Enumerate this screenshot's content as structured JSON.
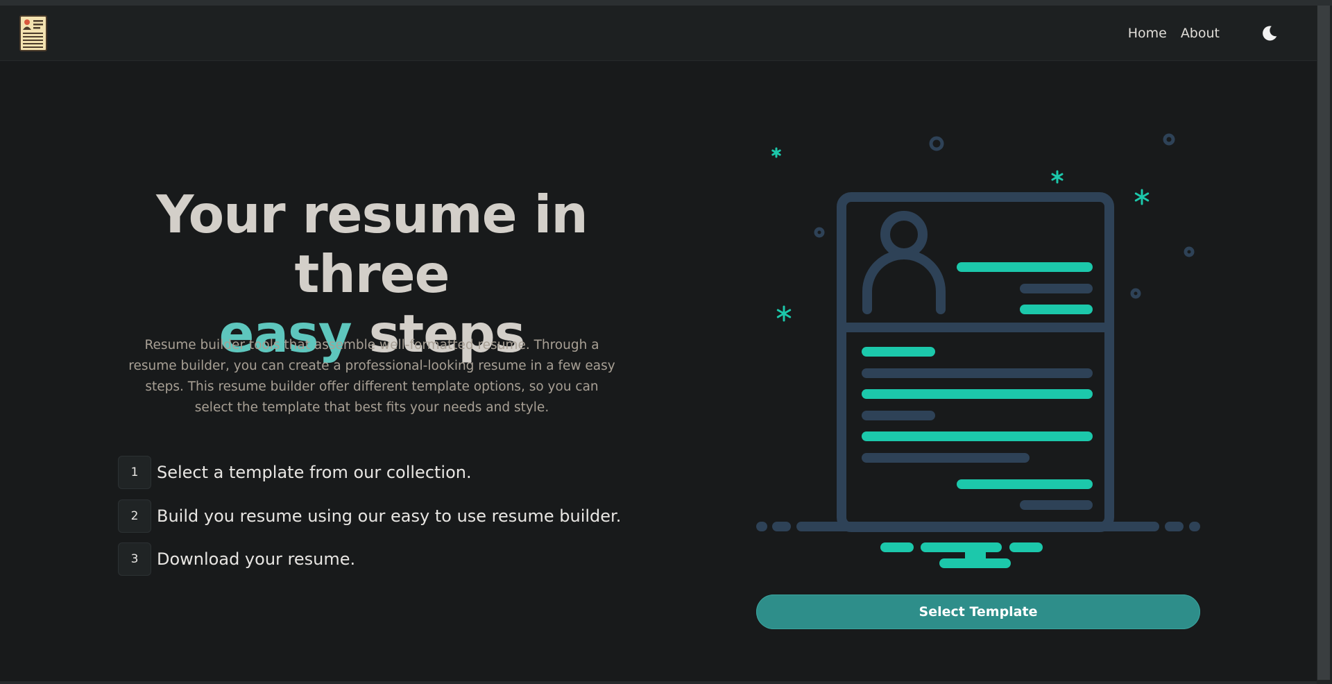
{
  "nav": {
    "links": [
      "Home",
      "About"
    ]
  },
  "hero": {
    "title_line1": "Your resume in three",
    "title_accent": "easy",
    "title_rest": " steps",
    "description": "Resume builder tools that assemble well-formatted resume. Through a resume builder, you can create a professional-looking resume in a few easy steps. This resume builder offer different template options, so you can select the template that best fits your needs and style."
  },
  "steps": [
    {
      "number": "1",
      "text": "Select a template from our collection."
    },
    {
      "number": "2",
      "text": "Build you resume using our easy to use resume builder."
    },
    {
      "number": "3",
      "text": "Download your resume."
    }
  ],
  "cta": {
    "label": "Select Template"
  },
  "colors": {
    "accent": "#5ec6bd",
    "illustration_teal": "#1cc8ab",
    "illustration_slate": "#2e4257",
    "button": "#2e8e8a",
    "background": "#181a1b"
  },
  "icons": {
    "logo": "resume-document-icon",
    "theme_toggle": "moon-icon",
    "illustration": "resume-monitor-illustration"
  }
}
